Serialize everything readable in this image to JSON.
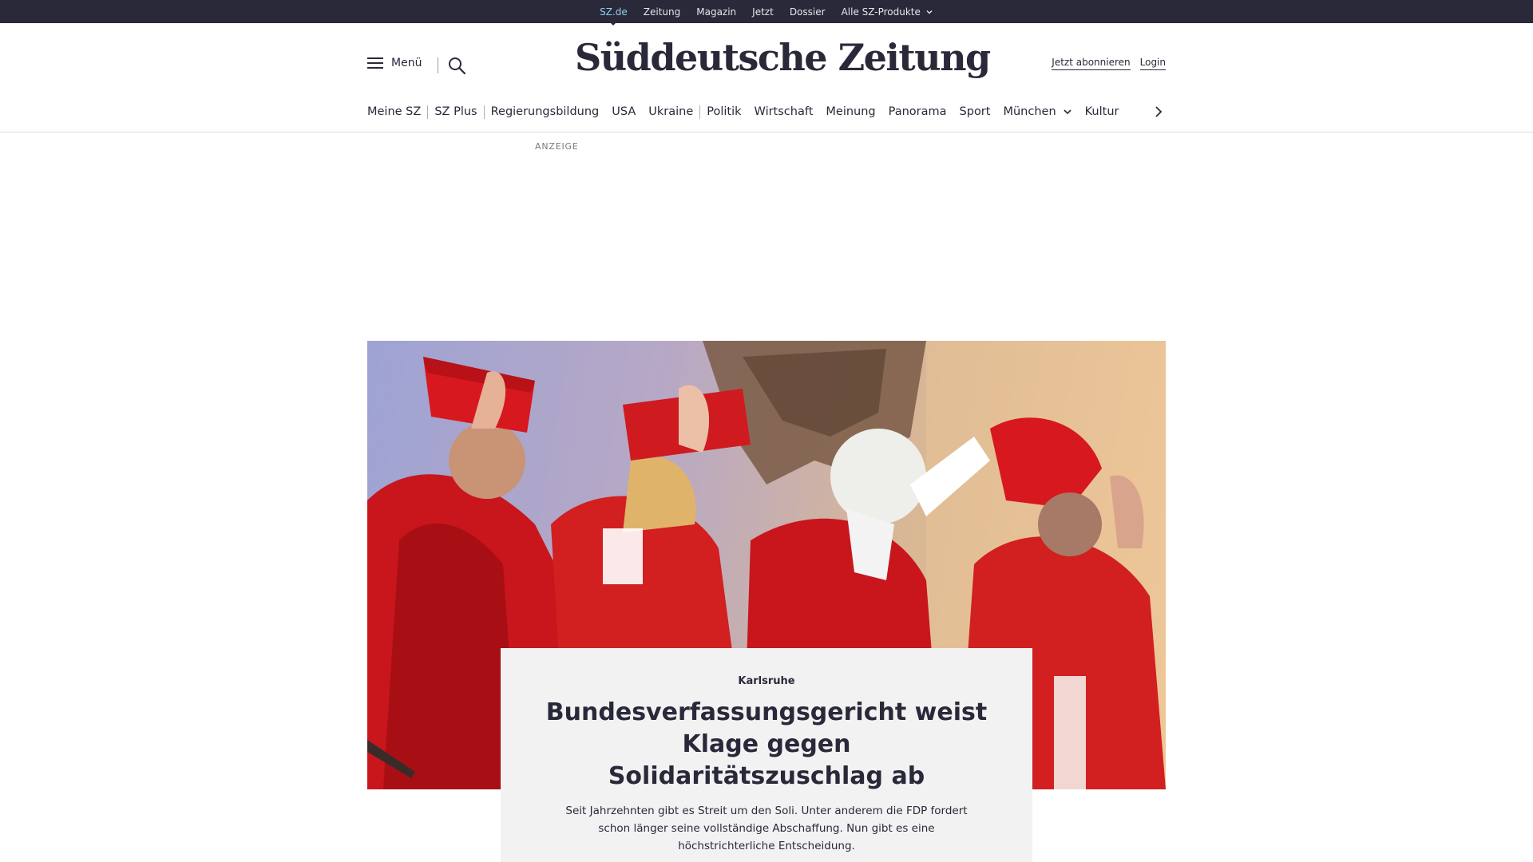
{
  "topbar": {
    "items": [
      "SZ.de",
      "Zeitung",
      "Magazin",
      "Jetzt",
      "Dossier",
      "Alle SZ-Produkte"
    ]
  },
  "header": {
    "menu_label": "Menü",
    "logo": "Süddeutsche Zeitung",
    "subscribe_label": "Jetzt abonnieren",
    "login_label": "Login"
  },
  "ressorts": {
    "items": [
      "Meine SZ",
      "SZ Plus",
      "Regierungsbildung",
      "USA",
      "Ukraine",
      "Politik",
      "Wirtschaft",
      "Meinung",
      "Panorama",
      "Sport",
      "München",
      "Kultur"
    ]
  },
  "ad": {
    "label": "ANZEIGE"
  },
  "teaser": {
    "kicker": "Karlsruhe",
    "headline": "Bundesverfassungsgericht weist Klage gegen Solidaritätszuschlag ab",
    "summary": "Seit Jahrzehnten gibt es Streit um den Soli. Unter anderem die FDP fordert schon länger seine vollständige Abschaffung. Nun gibt es eine höchstrichterliche Entscheidung."
  },
  "colors": {
    "topbar_bg": "#29293a",
    "active_link": "#8fd0f0",
    "robe_red": "#d21f1f",
    "teaser_bg": "#f2f2f3"
  }
}
